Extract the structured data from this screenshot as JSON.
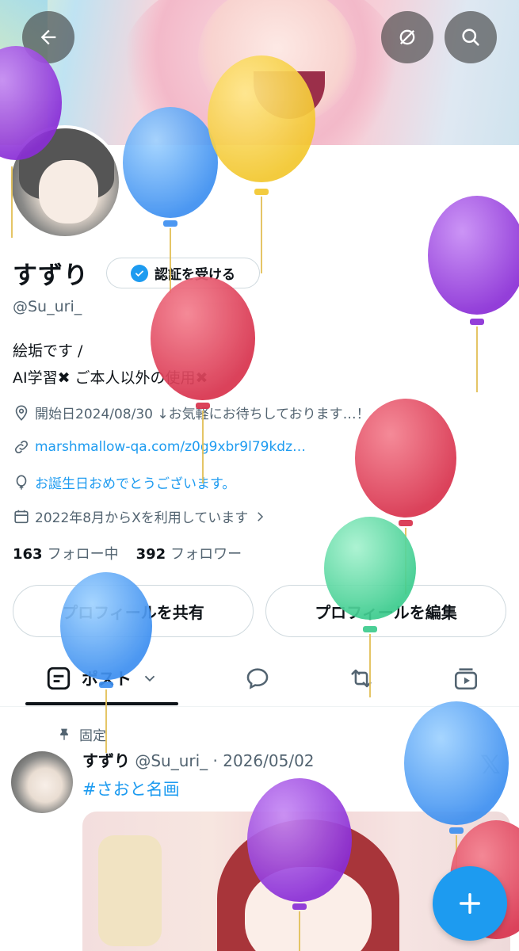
{
  "header": {
    "back_icon": "arrow-left-icon",
    "explore_icon": "no-image-icon",
    "search_icon": "search-icon"
  },
  "profile": {
    "name": "すずり",
    "verify_label": "認証を受ける",
    "handle": "@Su_uri_",
    "bio_line1": "絵垢です /",
    "bio_line2": "AI学習✖ ご本人以外の使用✖",
    "location": "開始日2024/08/30 ↓お気軽にお待ちしております…！",
    "website": "marshmallow-qa.com/z0g9xbr9l79kdz…",
    "birthday": "お誕生日おめでとうございます。",
    "joined": "2022年8月からXを利用しています",
    "following_count": "163",
    "following_label": "フォロー中",
    "followers_count": "392",
    "followers_label": "フォロワー"
  },
  "actions": {
    "share_label": "プロフィールを共有",
    "edit_label": "プロフィールを編集"
  },
  "tabs": {
    "posts_label": "ポスト"
  },
  "post": {
    "pinned_label": "固定",
    "author": "すずり",
    "meta": "@Su_uri_ · 2026/05/02",
    "hashtag": "#さおと名画"
  },
  "colors": {
    "accent": "#1d9bf0",
    "text": "#0f1419",
    "muted": "#536471"
  }
}
